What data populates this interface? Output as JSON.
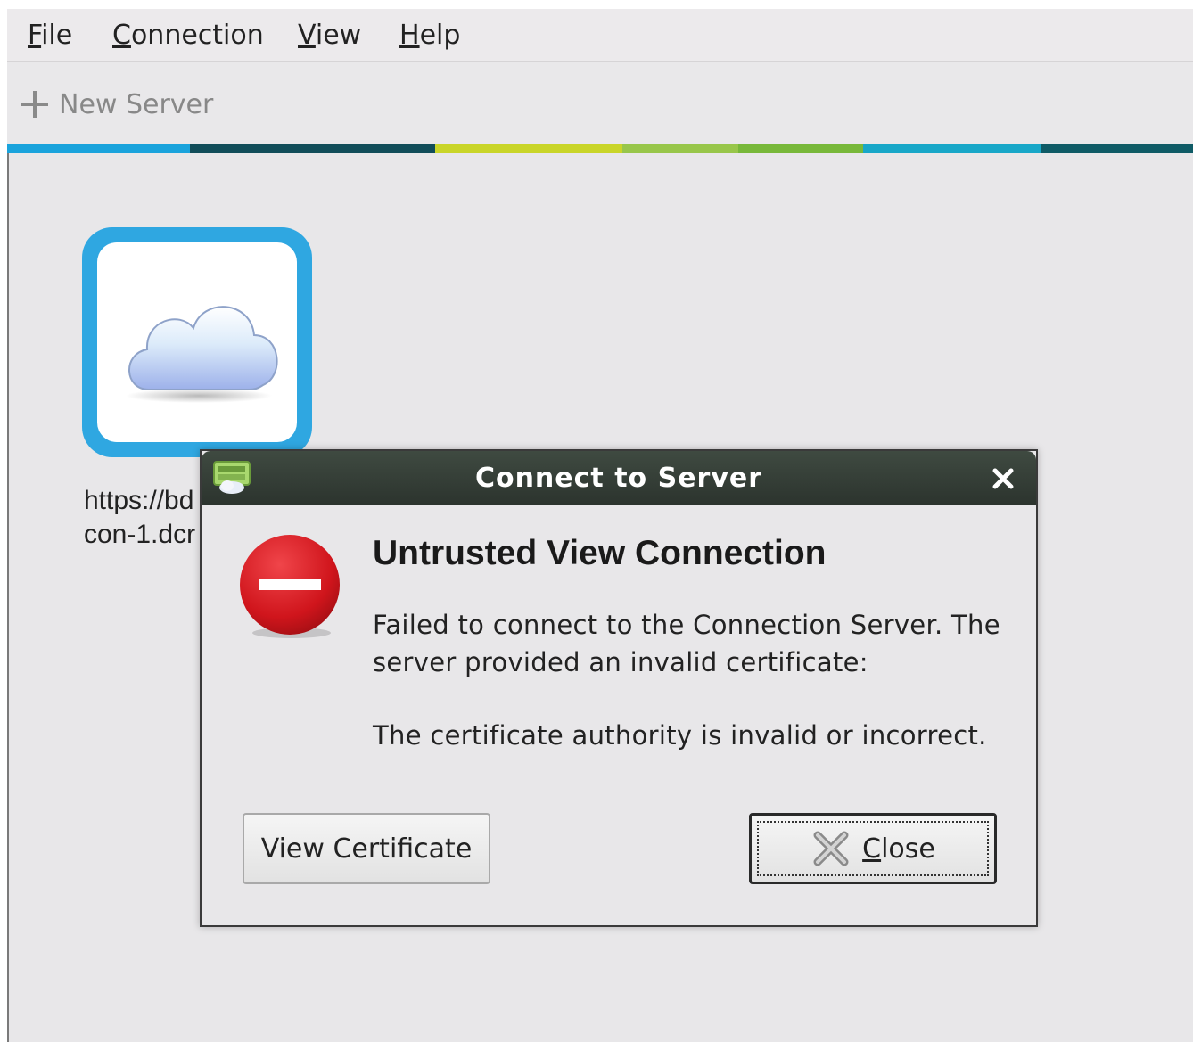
{
  "menubar": {
    "items": [
      {
        "label": "ile",
        "mnemonic": "F"
      },
      {
        "label": "onnection",
        "mnemonic": "C"
      },
      {
        "label": "iew",
        "mnemonic": "V"
      },
      {
        "label": "elp",
        "mnemonic": "H"
      }
    ]
  },
  "toolbar": {
    "new_server_label": "New Server",
    "new_server_icon": "plus-icon"
  },
  "server_tile": {
    "icon": "cloud-icon",
    "label_line1": "https://bd",
    "label_line2": "con-1.dcr"
  },
  "dialog": {
    "title": "Connect to Server",
    "icon": "error-icon",
    "heading": "Untrusted View Connection",
    "message_line1": "Failed to connect to the Connection Server. The",
    "message_line2": "server provided an invalid certificate:",
    "message_line3": "The certificate authority is invalid or incorrect.",
    "view_certificate_label": "View Certificate",
    "close_label_mnemonic": "C",
    "close_label_rest": "lose"
  },
  "colors": {
    "accent_blue": "#2fa7e1",
    "titlebar": "#2c342e",
    "error_red": "#d0151c"
  }
}
